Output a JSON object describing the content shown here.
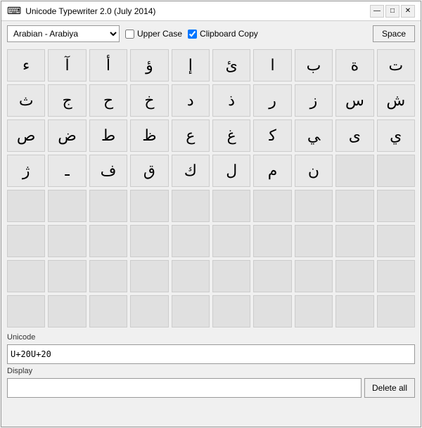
{
  "window": {
    "title": "Unicode Typewriter 2.0 (July 2014)",
    "icon": "⌨"
  },
  "titlebar": {
    "minimize": "—",
    "maximize": "□",
    "close": "✕"
  },
  "toolbar": {
    "dropdown_value": "Arabian      - Arabiya",
    "dropdown_options": [
      "Arabian - Arabiya"
    ],
    "uppercase_label": "Upper Case",
    "uppercase_checked": false,
    "clipboard_label": "Clipboard Copy",
    "clipboard_checked": true,
    "space_label": "Space"
  },
  "characters": [
    "ء",
    "آ",
    "أ",
    "ؤ",
    "إ",
    "ئ",
    "ا",
    "ب",
    "ة",
    "ت",
    "ث",
    "ج",
    "ح",
    "خ",
    "د",
    "ذ",
    "ر",
    "ز",
    "س",
    "ش",
    "ص",
    "ض",
    "ط",
    "ظ",
    "ع",
    "غ",
    "ﻛ",
    "ﻲ",
    "ى",
    "ي",
    "ژ",
    "ـ",
    "ف",
    "ق",
    "ك",
    "ل",
    "م",
    "ن",
    "",
    "",
    "",
    "",
    "",
    "",
    "",
    "",
    "",
    "",
    "",
    "",
    "",
    "",
    "",
    "",
    "",
    "",
    "",
    "",
    "",
    "",
    "",
    "",
    "",
    "",
    "",
    "",
    "",
    "",
    "",
    "",
    "",
    "",
    "",
    "",
    "",
    "",
    "",
    "",
    "",
    ""
  ],
  "unicode_field": {
    "label": "Unicode",
    "value": "U+20U+20"
  },
  "display_field": {
    "label": "Display",
    "value": ""
  },
  "delete_button": {
    "label": "Delete all"
  }
}
